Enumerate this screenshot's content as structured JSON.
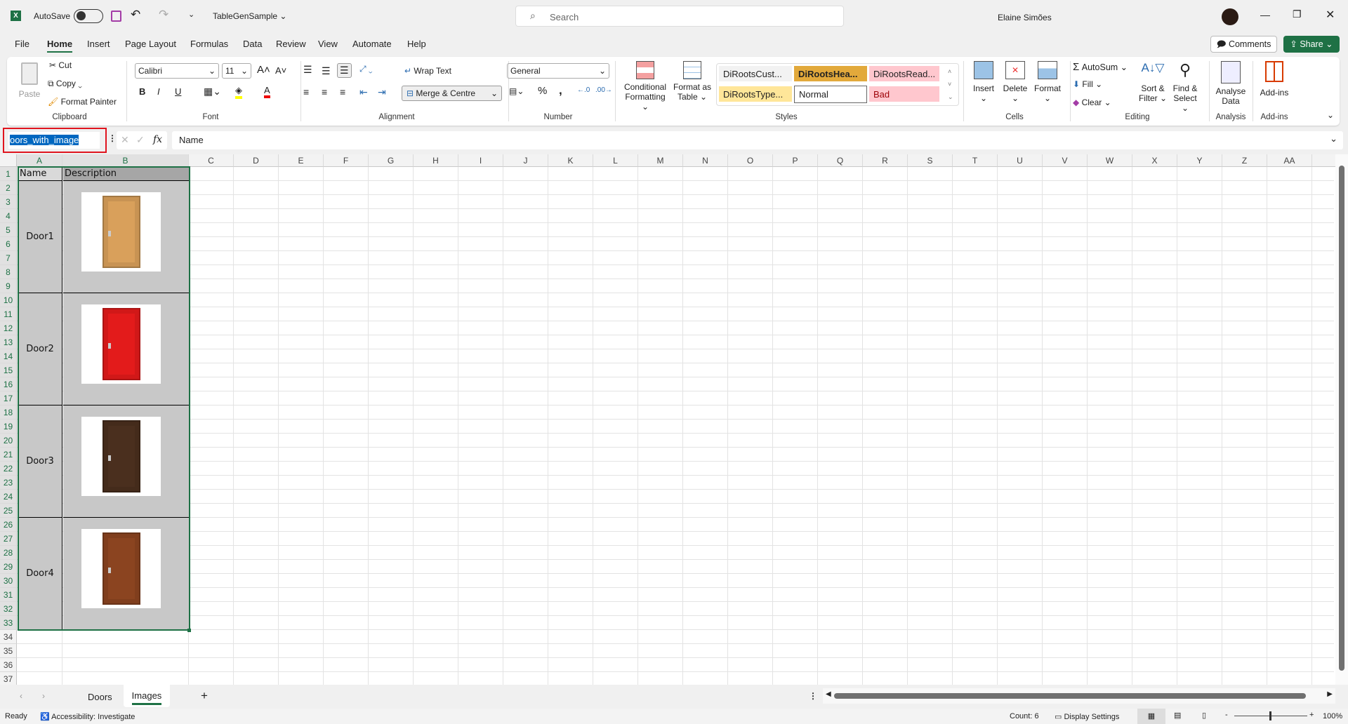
{
  "titlebar": {
    "autosave": "AutoSave",
    "autosave_on": false,
    "filename": "TableGenSample",
    "search_placeholder": "Search",
    "user": "Elaine Simões"
  },
  "menu": [
    "File",
    "Home",
    "Insert",
    "Page Layout",
    "Formulas",
    "Data",
    "Review",
    "View",
    "Automate",
    "Help"
  ],
  "active_menu": "Home",
  "actions": {
    "comments": "Comments",
    "share": "Share"
  },
  "ribbon": {
    "clipboard": {
      "label": "Clipboard",
      "paste": "Paste",
      "cut": "Cut",
      "copy": "Copy",
      "format_painter": "Format Painter"
    },
    "font": {
      "label": "Font",
      "name": "Calibri",
      "size": "11",
      "bold": "B",
      "italic": "I",
      "underline": "U"
    },
    "alignment": {
      "label": "Alignment",
      "wrap": "Wrap Text",
      "merge": "Merge & Centre"
    },
    "number": {
      "label": "Number",
      "format": "General"
    },
    "styles": {
      "label": "Styles",
      "conditional": "Conditional Formatting",
      "format_table": "Format as Table",
      "cells": [
        {
          "text": "DiRootsCust...",
          "bg": "#f2f2f2",
          "fg": "#222"
        },
        {
          "text": "DiRootsHea...",
          "bg": "#e2a93b",
          "fg": "#111"
        },
        {
          "text": "DiRootsRead...",
          "bg": "#ffc7ce",
          "fg": "#222"
        },
        {
          "text": "DiRootsType...",
          "bg": "#ffe699",
          "fg": "#222"
        },
        {
          "text": "Normal",
          "bg": "#ffffff",
          "fg": "#111"
        },
        {
          "text": "Bad",
          "bg": "#ffc7ce",
          "fg": "#9c0006"
        }
      ]
    },
    "cells": {
      "label": "Cells",
      "insert": "Insert",
      "delete": "Delete",
      "format": "Format"
    },
    "editing": {
      "label": "Editing",
      "autosum": "AutoSum",
      "fill": "Fill",
      "clear": "Clear",
      "sort": "Sort & Filter",
      "find": "Find & Select"
    },
    "analysis": {
      "label": "Analysis",
      "analyse": "Analyse Data"
    },
    "addins": {
      "label": "Add-ins",
      "addins": "Add-ins"
    }
  },
  "formula_bar": {
    "name_box": "oors_with_image",
    "fx": "fx",
    "content": "Name"
  },
  "columns": [
    "A",
    "B",
    "C",
    "D",
    "E",
    "F",
    "G",
    "H",
    "I",
    "J",
    "K",
    "L",
    "M",
    "N",
    "O",
    "P",
    "Q",
    "R",
    "S",
    "T",
    "U",
    "V",
    "W",
    "X",
    "Y",
    "Z",
    "AA"
  ],
  "row_count": 37,
  "table": {
    "headers": [
      "Name",
      "Description"
    ],
    "rows": [
      {
        "name": "Door1",
        "image": "door-light-wood-icon",
        "color": "#d9a05b"
      },
      {
        "name": "Door2",
        "image": "door-red-icon",
        "color": "#e31b1b"
      },
      {
        "name": "Door3",
        "image": "door-dark-wood-icon",
        "color": "#4a2f1e"
      },
      {
        "name": "Door4",
        "image": "door-mahogany-icon",
        "color": "#8b4420"
      }
    ]
  },
  "sheets": {
    "tabs": [
      "Doors",
      "Images"
    ],
    "active": "Images"
  },
  "status": {
    "ready": "Ready",
    "accessibility": "Accessibility: Investigate",
    "count": "Count: 6",
    "display": "Display Settings",
    "zoom": "100%"
  }
}
